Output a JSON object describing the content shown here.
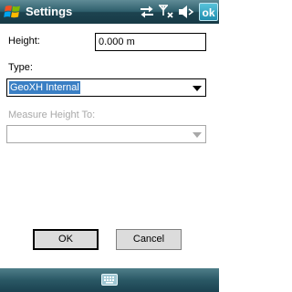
{
  "titlebar": {
    "title": "Settings",
    "ok_label": "ok",
    "icons": [
      "windows-start-icon",
      "sync-icon",
      "no-signal-icon",
      "volume-off-icon"
    ]
  },
  "form": {
    "height_label": "Height:",
    "height_value": "0.000 m",
    "type_label": "Type:",
    "type_value": "GeoXH Internal",
    "measure_label": "Measure Height To:",
    "measure_value": ""
  },
  "buttons": {
    "ok_label": "OK",
    "cancel_label": "Cancel"
  },
  "bottombar": {
    "icons": [
      "keyboard-icon"
    ]
  },
  "colors": {
    "titlebar": "#2f5f6c",
    "selection": "#3a7fc4",
    "disabled_text": "#a8a8a8",
    "ok_accent": "#1f8fb0"
  }
}
